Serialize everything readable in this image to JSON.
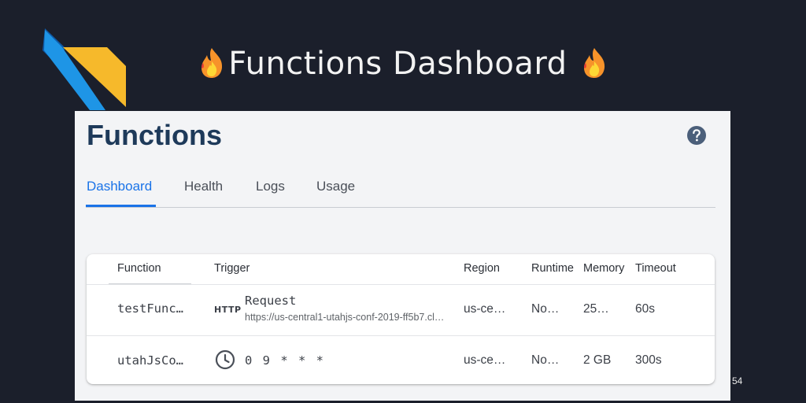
{
  "slide": {
    "title": "Functions Dashboard",
    "page_number": "54"
  },
  "console": {
    "title": "Functions",
    "tabs": [
      {
        "label": "Dashboard",
        "active": true
      },
      {
        "label": "Health",
        "active": false
      },
      {
        "label": "Logs",
        "active": false
      },
      {
        "label": "Usage",
        "active": false
      }
    ],
    "table": {
      "headers": [
        "Function",
        "Trigger",
        "Region",
        "Runtime",
        "Memory",
        "Timeout"
      ],
      "rows": [
        {
          "function": "testFunc…",
          "trigger_badge": "HTTP",
          "trigger_label": "Request",
          "trigger_url": "https://us-central1-utahjs-conf-2019-ff5b7.cl…",
          "region": "us-ce…",
          "runtime": "No…",
          "memory": "25…",
          "timeout": "60s"
        },
        {
          "function": "utahJsCo…",
          "trigger_icon": "clock-icon",
          "trigger_label": "0 9 * * *",
          "region": "us-ce…",
          "runtime": "No…",
          "memory": "2 GB",
          "timeout": "300s"
        }
      ]
    }
  },
  "colors": {
    "slide_bg": "#1b1f2b",
    "accent_blue": "#1a73e8",
    "title_navy": "#1e3a5a",
    "logo_blue": "#2196f3",
    "logo_yellow": "#fbc02d"
  }
}
